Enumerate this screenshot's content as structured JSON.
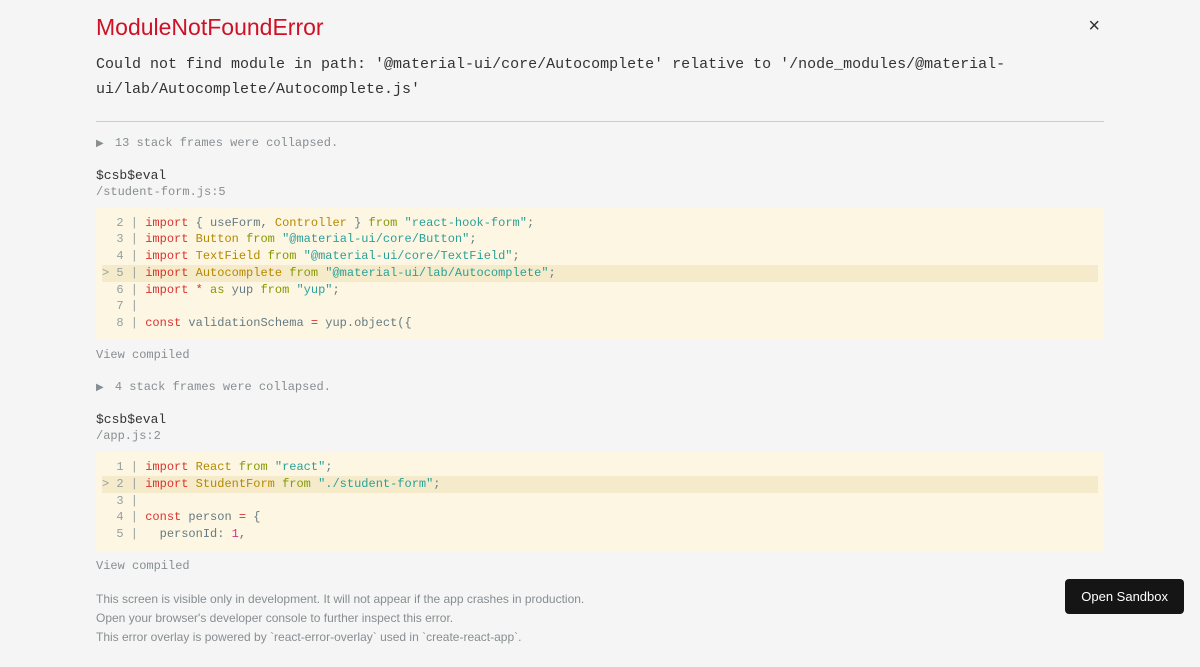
{
  "error": {
    "title": "ModuleNotFoundError",
    "message": "Could not find module in path: '@material-ui/core/Autocomplete' relative to '/node_modules/@material-ui/lab/Autocomplete/Autocomplete.js'"
  },
  "close_label": "×",
  "frames": [
    {
      "collapsed_text": "13 stack frames were collapsed.",
      "name": "$csb$eval",
      "location": "/student-form.js:5",
      "view_compiled": "View compiled",
      "code": {
        "lines": [
          {
            "n": "2",
            "hl": false,
            "marker": " ",
            "tokens": [
              [
                "kw",
                "import"
              ],
              [
                "punct",
                " { "
              ],
              [
                "ident",
                "useForm"
              ],
              [
                "punct",
                ", "
              ],
              [
                "cls",
                "Controller"
              ],
              [
                "punct",
                " } "
              ],
              [
                "kw2",
                "from"
              ],
              [
                "punct",
                " "
              ],
              [
                "str",
                "\"react-hook-form\""
              ],
              [
                "punct",
                ";"
              ]
            ]
          },
          {
            "n": "3",
            "hl": false,
            "marker": " ",
            "tokens": [
              [
                "kw",
                "import"
              ],
              [
                "punct",
                " "
              ],
              [
                "cls",
                "Button"
              ],
              [
                "punct",
                " "
              ],
              [
                "kw2",
                "from"
              ],
              [
                "punct",
                " "
              ],
              [
                "str",
                "\"@material-ui/core/Button\""
              ],
              [
                "punct",
                ";"
              ]
            ]
          },
          {
            "n": "4",
            "hl": false,
            "marker": " ",
            "tokens": [
              [
                "kw",
                "import"
              ],
              [
                "punct",
                " "
              ],
              [
                "cls",
                "TextField"
              ],
              [
                "punct",
                " "
              ],
              [
                "kw2",
                "from"
              ],
              [
                "punct",
                " "
              ],
              [
                "str",
                "\"@material-ui/core/TextField\""
              ],
              [
                "punct",
                ";"
              ]
            ]
          },
          {
            "n": "5",
            "hl": true,
            "marker": ">",
            "tokens": [
              [
                "kw",
                "import"
              ],
              [
                "punct",
                " "
              ],
              [
                "cls",
                "Autocomplete"
              ],
              [
                "punct",
                " "
              ],
              [
                "kw2",
                "from"
              ],
              [
                "punct",
                " "
              ],
              [
                "str",
                "\"@material-ui/lab/Autocomplete\""
              ],
              [
                "punct",
                ";"
              ]
            ]
          },
          {
            "n": "6",
            "hl": false,
            "marker": " ",
            "tokens": [
              [
                "kw",
                "import"
              ],
              [
                "punct",
                " "
              ],
              [
                "kw",
                "*"
              ],
              [
                "punct",
                " "
              ],
              [
                "kw2",
                "as"
              ],
              [
                "ident",
                " yup "
              ],
              [
                "kw2",
                "from"
              ],
              [
                "punct",
                " "
              ],
              [
                "str",
                "\"yup\""
              ],
              [
                "punct",
                ";"
              ]
            ]
          },
          {
            "n": "7",
            "hl": false,
            "marker": " ",
            "tokens": []
          },
          {
            "n": "8",
            "hl": false,
            "marker": " ",
            "tokens": [
              [
                "kw",
                "const"
              ],
              [
                "ident",
                " validationSchema "
              ],
              [
                "kw",
                "="
              ],
              [
                "ident",
                " yup"
              ],
              [
                "punct",
                ".object({"
              ]
            ]
          }
        ]
      }
    },
    {
      "collapsed_text": "4 stack frames were collapsed.",
      "name": "$csb$eval",
      "location": "/app.js:2",
      "view_compiled": "View compiled",
      "code": {
        "lines": [
          {
            "n": "1",
            "hl": false,
            "marker": " ",
            "tokens": [
              [
                "kw",
                "import"
              ],
              [
                "punct",
                " "
              ],
              [
                "cls",
                "React"
              ],
              [
                "punct",
                " "
              ],
              [
                "kw2",
                "from"
              ],
              [
                "punct",
                " "
              ],
              [
                "str",
                "\"react\""
              ],
              [
                "punct",
                ";"
              ]
            ]
          },
          {
            "n": "2",
            "hl": true,
            "marker": ">",
            "tokens": [
              [
                "kw",
                "import"
              ],
              [
                "punct",
                " "
              ],
              [
                "cls",
                "StudentForm"
              ],
              [
                "punct",
                " "
              ],
              [
                "kw2",
                "from"
              ],
              [
                "punct",
                " "
              ],
              [
                "str",
                "\"./student-form\""
              ],
              [
                "punct",
                ";"
              ]
            ]
          },
          {
            "n": "3",
            "hl": false,
            "marker": " ",
            "tokens": []
          },
          {
            "n": "4",
            "hl": false,
            "marker": " ",
            "tokens": [
              [
                "kw",
                "const"
              ],
              [
                "ident",
                " person "
              ],
              [
                "kw",
                "="
              ],
              [
                "punct",
                " {"
              ]
            ]
          },
          {
            "n": "5",
            "hl": false,
            "marker": " ",
            "tokens": [
              [
                "ident",
                "  personId"
              ],
              [
                "punct",
                ": "
              ],
              [
                "num",
                "1"
              ],
              [
                "punct",
                ","
              ]
            ]
          }
        ]
      }
    }
  ],
  "footer": {
    "line1": "This screen is visible only in development. It will not appear if the app crashes in production.",
    "line2": "Open your browser's developer console to further inspect this error.",
    "line3": "This error overlay is powered by `react-error-overlay` used in `create-react-app`."
  },
  "sandbox_button": "Open Sandbox"
}
